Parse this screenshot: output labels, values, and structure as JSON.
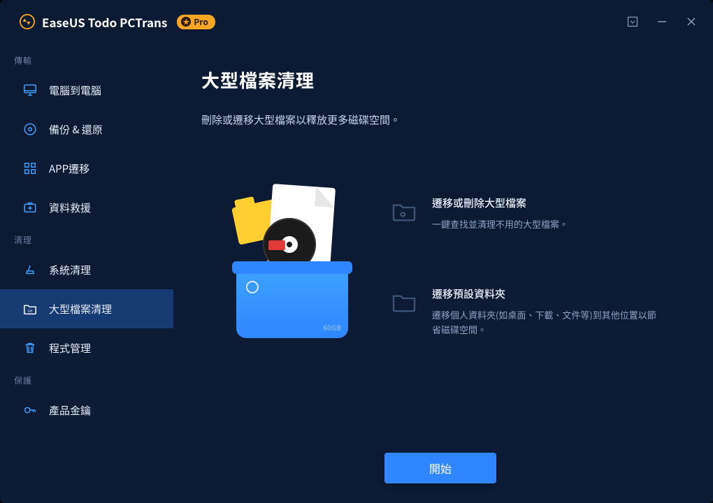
{
  "titlebar": {
    "app_name": "EaseUS Todo PCTrans",
    "pro_label": "Pro"
  },
  "sidebar": {
    "sections": [
      {
        "label": "傳輸",
        "items": [
          {
            "id": "pc-to-pc",
            "label": "電腦到電腦"
          },
          {
            "id": "backup-restore",
            "label": "備份 & 還原"
          },
          {
            "id": "app-migration",
            "label": "APP遷移"
          },
          {
            "id": "data-rescue",
            "label": "資料救援"
          }
        ]
      },
      {
        "label": "清理",
        "items": [
          {
            "id": "system-cleanup",
            "label": "系統清理"
          },
          {
            "id": "large-file-cleanup",
            "label": "大型檔案清理",
            "active": true
          },
          {
            "id": "app-management",
            "label": "程式管理"
          }
        ]
      },
      {
        "label": "保護",
        "items": [
          {
            "id": "product-key",
            "label": "產品金鑰"
          }
        ]
      }
    ]
  },
  "main": {
    "title": "大型檔案清理",
    "subtitle": "刪除或遷移大型檔案以釋放更多磁碟空間。",
    "options": [
      {
        "id": "migrate-delete-large",
        "title": "遷移或刪除大型檔案",
        "desc": "一鍵查找並清理不用的大型檔案。"
      },
      {
        "id": "migrate-default-folders",
        "title": "遷移預設資料夾",
        "desc": "遷移個人資料夾(如桌面、下載、文件等)到其他位置以節省磁碟空間。"
      }
    ],
    "hero_capacity": "60GB",
    "start_label": "開始"
  }
}
